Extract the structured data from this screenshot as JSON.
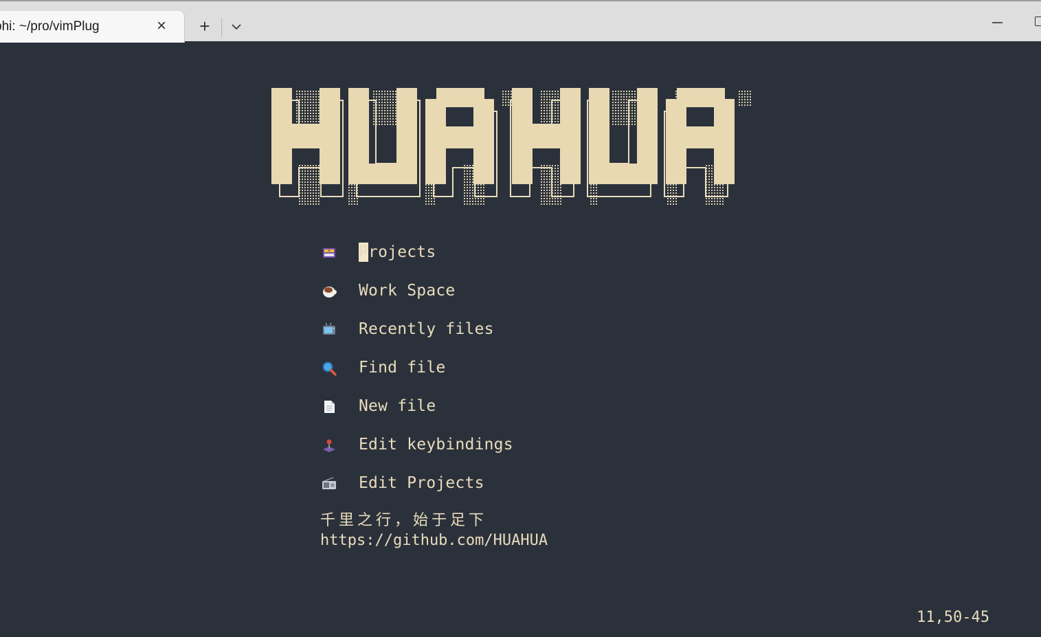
{
  "tab": {
    "title": "phi: ~/pro/vimPlug",
    "close_icon": "×"
  },
  "tabbar": {
    "new_tab_icon": "+"
  },
  "colors": {
    "background": "#2b313b",
    "text": "#e9dcbc",
    "cursor": "#f1e7cc"
  },
  "banner": {
    "text": "HUAHUA"
  },
  "menu": [
    {
      "icon": "file-cabinet-icon",
      "label": "Projects"
    },
    {
      "icon": "coffee-icon",
      "label": "Work Space"
    },
    {
      "icon": "television-icon",
      "label": "Recently files"
    },
    {
      "icon": "magnifier-icon",
      "label": "Find file"
    },
    {
      "icon": "document-icon",
      "label": "New file"
    },
    {
      "icon": "joystick-icon",
      "label": "Edit keybindings"
    },
    {
      "icon": "radio-icon",
      "label": "Edit Projects"
    }
  ],
  "footer": {
    "quote": "千里之行，始于足下",
    "url": "https://github.com/HUAHUA"
  },
  "status": {
    "ruler": "11,50-45"
  }
}
